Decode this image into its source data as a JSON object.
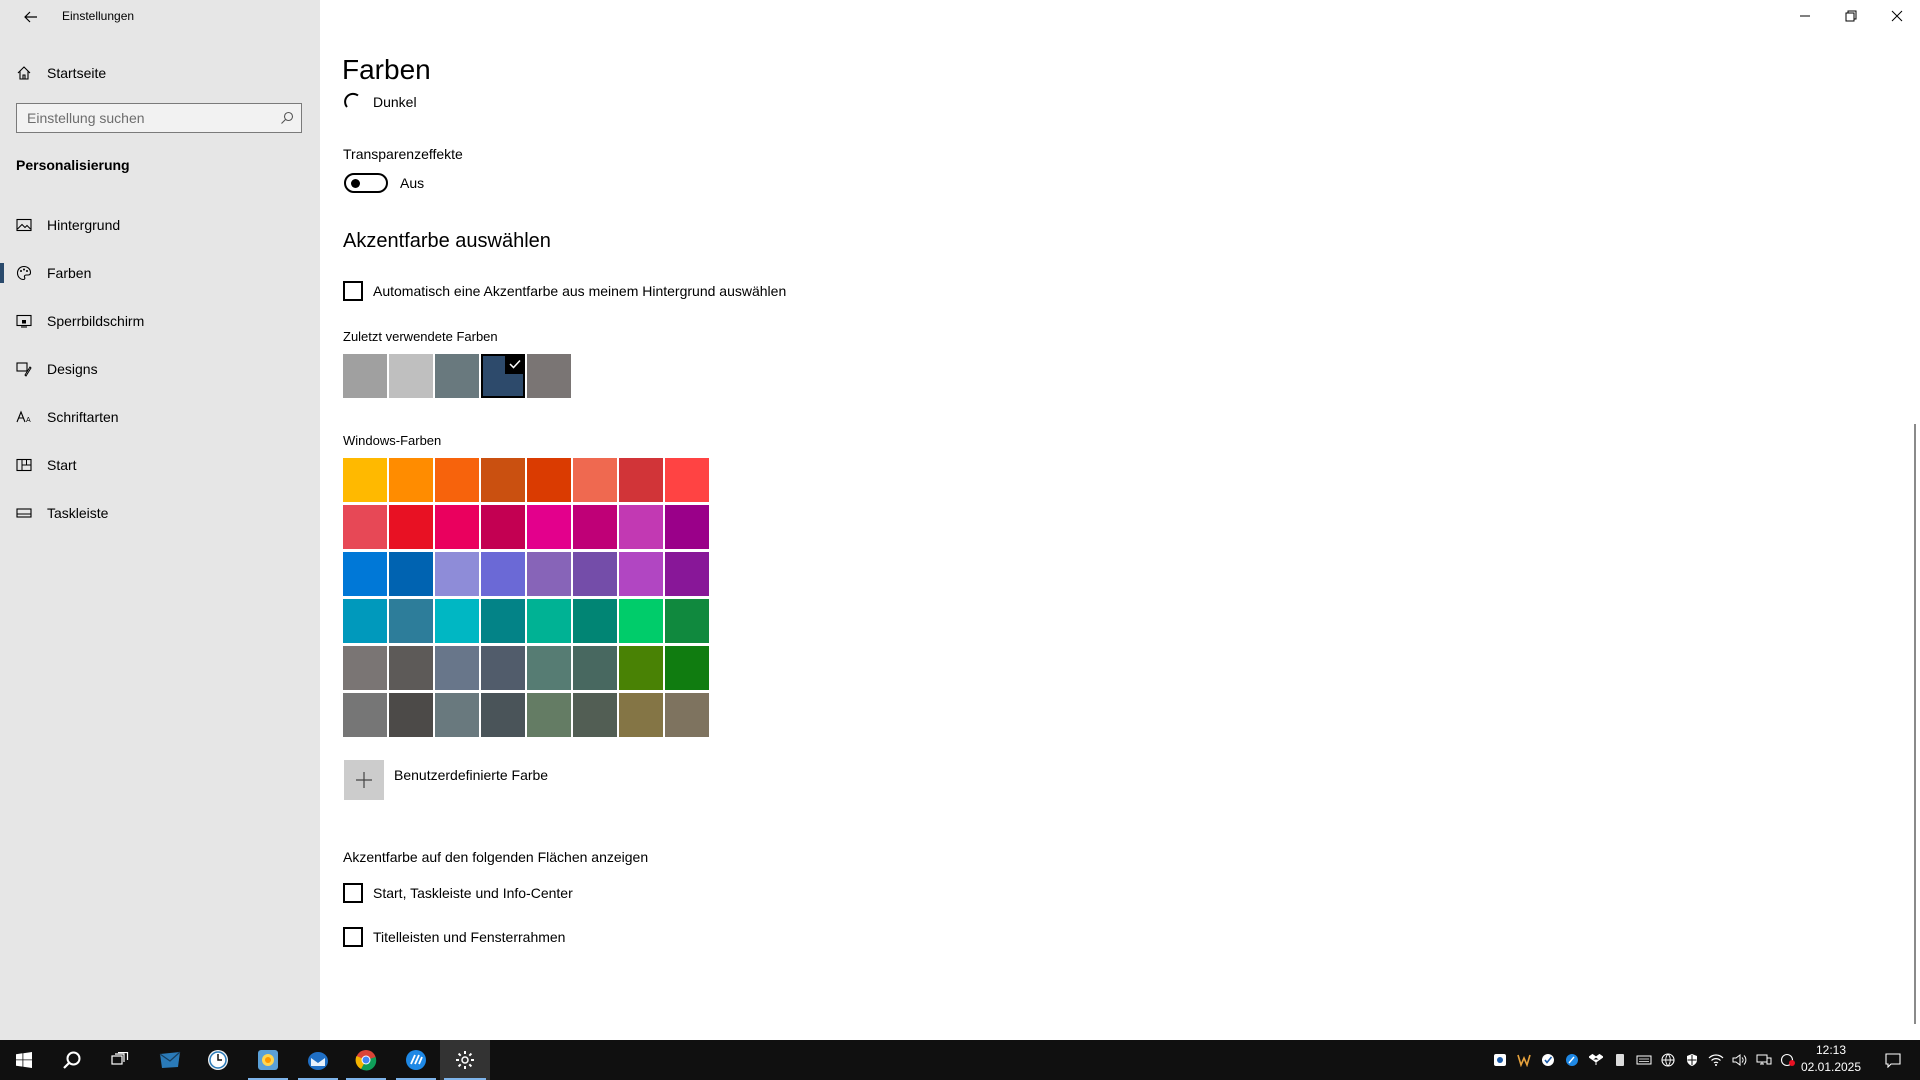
{
  "window": {
    "title": "Einstellungen",
    "controls": [
      "minimize",
      "restore",
      "close"
    ]
  },
  "sidebar": {
    "home_label": "Startseite",
    "search_placeholder": "Einstellung suchen",
    "section_title": "Personalisierung",
    "items": [
      {
        "label": "Hintergrund",
        "icon": "picture-icon",
        "selected": false
      },
      {
        "label": "Farben",
        "icon": "palette-icon",
        "selected": true
      },
      {
        "label": "Sperrbildschirm",
        "icon": "lock-screen-icon",
        "selected": false
      },
      {
        "label": "Designs",
        "icon": "brush-icon",
        "selected": false
      },
      {
        "label": "Schriftarten",
        "icon": "font-icon",
        "selected": false
      },
      {
        "label": "Start",
        "icon": "start-menu-icon",
        "selected": false
      },
      {
        "label": "Taskleiste",
        "icon": "taskbar-icon",
        "selected": false
      }
    ]
  },
  "main": {
    "title": "Farben",
    "mode_option": "Dunkel",
    "transparency": {
      "label": "Transparenzeffekte",
      "state": "Aus"
    },
    "accent_heading": "Akzentfarbe auswählen",
    "auto_accent_label": "Automatisch eine Akzentfarbe aus meinem Hintergrund auswählen",
    "recent_label": "Zuletzt verwendete Farben",
    "recent_colors": [
      "#a0a0a0",
      "#bfbfbf",
      "#69797e",
      "#2d4a6b",
      "#7a7574"
    ],
    "selected_recent": 3,
    "windows_colors_label": "Windows-Farben",
    "windows_colors": [
      "#ffb900",
      "#ff8c00",
      "#f7630c",
      "#ca5010",
      "#da3b01",
      "#ef6950",
      "#d13438",
      "#ff4343",
      "#e74856",
      "#e81123",
      "#ea005e",
      "#c30052",
      "#e3008c",
      "#bf0077",
      "#c239b3",
      "#9a0089",
      "#0078d7",
      "#0063b1",
      "#8e8cd8",
      "#6b69d6",
      "#8764b8",
      "#744da9",
      "#b146c2",
      "#881798",
      "#0099bc",
      "#2d7d9a",
      "#00b7c3",
      "#038387",
      "#00b294",
      "#018574",
      "#00cc6a",
      "#10893e",
      "#7a7574",
      "#5d5a58",
      "#68768a",
      "#515c6b",
      "#567c73",
      "#486860",
      "#498205",
      "#107c10",
      "#767676",
      "#4c4a48",
      "#69797e",
      "#4a5459",
      "#647c64",
      "#525e54",
      "#847545",
      "#7e735f"
    ],
    "custom_color_label": "Benutzerdefinierte Farbe",
    "show_accent_label": "Akzentfarbe auf den folgenden Flächen anzeigen",
    "surface_options": [
      "Start, Taskleiste und Info-Center",
      "Titelleisten und Fensterrahmen"
    ]
  },
  "taskbar": {
    "apps": [
      "start-icon",
      "search-icon",
      "task-view-icon",
      "mail-icon",
      "clock-app-icon",
      "photos-icon",
      "thunderbird-icon",
      "chrome-icon",
      "writer-icon",
      "settings-icon"
    ],
    "tray_icons": [
      "shield-icon",
      "w-app-icon",
      "check-icon",
      "feather-icon",
      "dropbox-icon",
      "usb-icon",
      "keyboard-icon",
      "globe-icon",
      "defender-icon",
      "wifi-icon",
      "volume-icon",
      "network-icon",
      "update-icon"
    ],
    "time": "12:13",
    "date": "02.01.2025"
  }
}
